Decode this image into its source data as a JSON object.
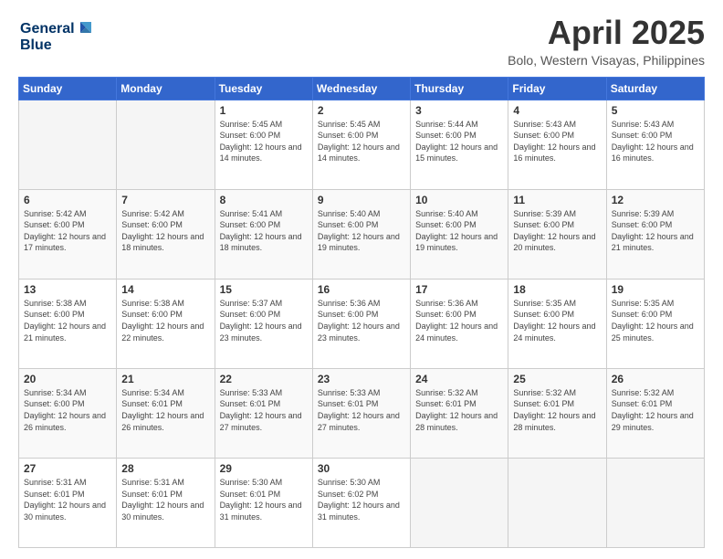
{
  "header": {
    "logo_line1": "General",
    "logo_line2": "Blue",
    "month": "April 2025",
    "location": "Bolo, Western Visayas, Philippines"
  },
  "weekdays": [
    "Sunday",
    "Monday",
    "Tuesday",
    "Wednesday",
    "Thursday",
    "Friday",
    "Saturday"
  ],
  "weeks": [
    [
      {
        "day": "",
        "info": ""
      },
      {
        "day": "",
        "info": ""
      },
      {
        "day": "1",
        "info": "Sunrise: 5:45 AM\nSunset: 6:00 PM\nDaylight: 12 hours and 14 minutes."
      },
      {
        "day": "2",
        "info": "Sunrise: 5:45 AM\nSunset: 6:00 PM\nDaylight: 12 hours and 14 minutes."
      },
      {
        "day": "3",
        "info": "Sunrise: 5:44 AM\nSunset: 6:00 PM\nDaylight: 12 hours and 15 minutes."
      },
      {
        "day": "4",
        "info": "Sunrise: 5:43 AM\nSunset: 6:00 PM\nDaylight: 12 hours and 16 minutes."
      },
      {
        "day": "5",
        "info": "Sunrise: 5:43 AM\nSunset: 6:00 PM\nDaylight: 12 hours and 16 minutes."
      }
    ],
    [
      {
        "day": "6",
        "info": "Sunrise: 5:42 AM\nSunset: 6:00 PM\nDaylight: 12 hours and 17 minutes."
      },
      {
        "day": "7",
        "info": "Sunrise: 5:42 AM\nSunset: 6:00 PM\nDaylight: 12 hours and 18 minutes."
      },
      {
        "day": "8",
        "info": "Sunrise: 5:41 AM\nSunset: 6:00 PM\nDaylight: 12 hours and 18 minutes."
      },
      {
        "day": "9",
        "info": "Sunrise: 5:40 AM\nSunset: 6:00 PM\nDaylight: 12 hours and 19 minutes."
      },
      {
        "day": "10",
        "info": "Sunrise: 5:40 AM\nSunset: 6:00 PM\nDaylight: 12 hours and 19 minutes."
      },
      {
        "day": "11",
        "info": "Sunrise: 5:39 AM\nSunset: 6:00 PM\nDaylight: 12 hours and 20 minutes."
      },
      {
        "day": "12",
        "info": "Sunrise: 5:39 AM\nSunset: 6:00 PM\nDaylight: 12 hours and 21 minutes."
      }
    ],
    [
      {
        "day": "13",
        "info": "Sunrise: 5:38 AM\nSunset: 6:00 PM\nDaylight: 12 hours and 21 minutes."
      },
      {
        "day": "14",
        "info": "Sunrise: 5:38 AM\nSunset: 6:00 PM\nDaylight: 12 hours and 22 minutes."
      },
      {
        "day": "15",
        "info": "Sunrise: 5:37 AM\nSunset: 6:00 PM\nDaylight: 12 hours and 23 minutes."
      },
      {
        "day": "16",
        "info": "Sunrise: 5:36 AM\nSunset: 6:00 PM\nDaylight: 12 hours and 23 minutes."
      },
      {
        "day": "17",
        "info": "Sunrise: 5:36 AM\nSunset: 6:00 PM\nDaylight: 12 hours and 24 minutes."
      },
      {
        "day": "18",
        "info": "Sunrise: 5:35 AM\nSunset: 6:00 PM\nDaylight: 12 hours and 24 minutes."
      },
      {
        "day": "19",
        "info": "Sunrise: 5:35 AM\nSunset: 6:00 PM\nDaylight: 12 hours and 25 minutes."
      }
    ],
    [
      {
        "day": "20",
        "info": "Sunrise: 5:34 AM\nSunset: 6:00 PM\nDaylight: 12 hours and 26 minutes."
      },
      {
        "day": "21",
        "info": "Sunrise: 5:34 AM\nSunset: 6:01 PM\nDaylight: 12 hours and 26 minutes."
      },
      {
        "day": "22",
        "info": "Sunrise: 5:33 AM\nSunset: 6:01 PM\nDaylight: 12 hours and 27 minutes."
      },
      {
        "day": "23",
        "info": "Sunrise: 5:33 AM\nSunset: 6:01 PM\nDaylight: 12 hours and 27 minutes."
      },
      {
        "day": "24",
        "info": "Sunrise: 5:32 AM\nSunset: 6:01 PM\nDaylight: 12 hours and 28 minutes."
      },
      {
        "day": "25",
        "info": "Sunrise: 5:32 AM\nSunset: 6:01 PM\nDaylight: 12 hours and 28 minutes."
      },
      {
        "day": "26",
        "info": "Sunrise: 5:32 AM\nSunset: 6:01 PM\nDaylight: 12 hours and 29 minutes."
      }
    ],
    [
      {
        "day": "27",
        "info": "Sunrise: 5:31 AM\nSunset: 6:01 PM\nDaylight: 12 hours and 30 minutes."
      },
      {
        "day": "28",
        "info": "Sunrise: 5:31 AM\nSunset: 6:01 PM\nDaylight: 12 hours and 30 minutes."
      },
      {
        "day": "29",
        "info": "Sunrise: 5:30 AM\nSunset: 6:01 PM\nDaylight: 12 hours and 31 minutes."
      },
      {
        "day": "30",
        "info": "Sunrise: 5:30 AM\nSunset: 6:02 PM\nDaylight: 12 hours and 31 minutes."
      },
      {
        "day": "",
        "info": ""
      },
      {
        "day": "",
        "info": ""
      },
      {
        "day": "",
        "info": ""
      }
    ]
  ]
}
